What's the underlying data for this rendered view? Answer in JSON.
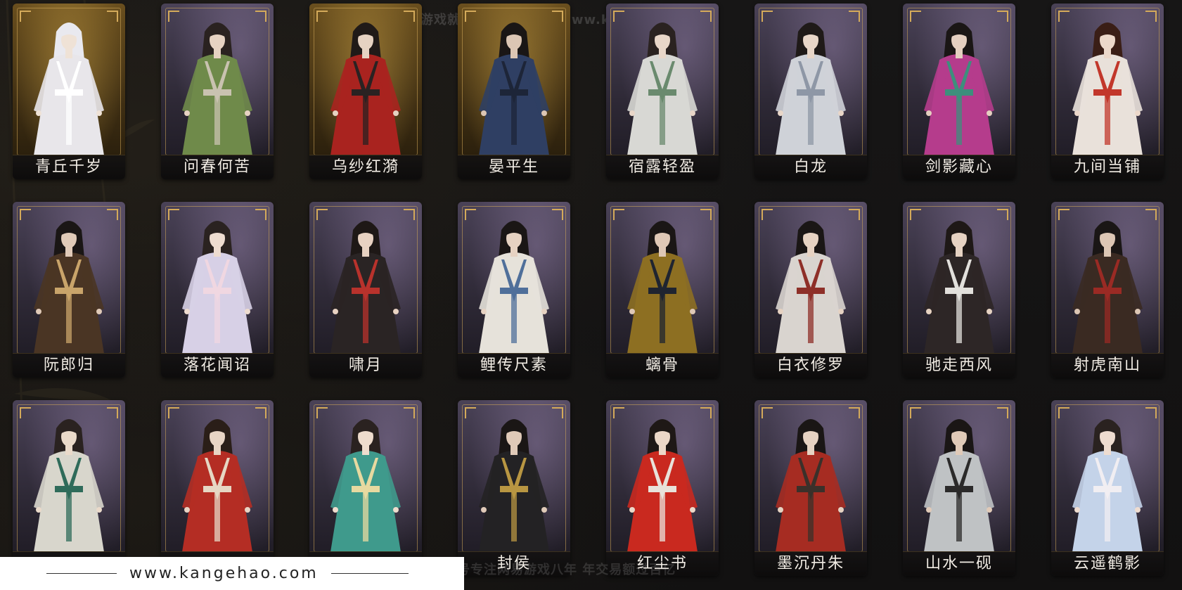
{
  "watermarks": {
    "top": "网易游戏就选看个号   网址：www.kangehao.com",
    "bottom": "看个号专注网易游戏八年   年交易额过百亿"
  },
  "footer": {
    "url": "www.kangehao.com"
  },
  "cards": [
    {
      "name": "青丘千岁",
      "frame": "gold",
      "outfit": "#e8e6ea",
      "trim": "#ffffff",
      "skin": "#efe2d6",
      "hair": "#e9e9ef"
    },
    {
      "name": "问春何苦",
      "frame": "purple",
      "outfit": "#6f8a4a",
      "trim": "#c9c2b0",
      "skin": "#e6d2c2",
      "hair": "#2a2220"
    },
    {
      "name": "乌纱红漪",
      "frame": "gold",
      "outfit": "#a9231f",
      "trim": "#2a2222",
      "skin": "#e6d2c2",
      "hair": "#201a18"
    },
    {
      "name": "晏平生",
      "frame": "gold",
      "outfit": "#2f3f63",
      "trim": "#1d2538",
      "skin": "#dcc6b4",
      "hair": "#1a1615"
    },
    {
      "name": "宿露轻盈",
      "frame": "purple",
      "outfit": "#d8d8d4",
      "trim": "#6a8a6e",
      "skin": "#e8d6c8",
      "hair": "#2a2220"
    },
    {
      "name": "白龙",
      "frame": "purple",
      "outfit": "#cfd2d8",
      "trim": "#8e97a6",
      "skin": "#e8d6c8",
      "hair": "#1f1a18"
    },
    {
      "name": "剑影藏心",
      "frame": "purple",
      "outfit": "#b53c8c",
      "trim": "#3d8f7c",
      "skin": "#e4cfc0",
      "hair": "#1a1615"
    },
    {
      "name": "九间当铺",
      "frame": "purple",
      "outfit": "#e9e1da",
      "trim": "#c2372b",
      "skin": "#ecd8ca",
      "hair": "#3a1e16"
    },
    {
      "name": "阮郎归",
      "frame": "purple",
      "outfit": "#4a3524",
      "trim": "#c9a46a",
      "skin": "#e0cab8",
      "hair": "#1a1615"
    },
    {
      "name": "落花闻诏",
      "frame": "purple",
      "outfit": "#d7d0e6",
      "trim": "#f0d7e1",
      "skin": "#eedcd0",
      "hair": "#2a2220"
    },
    {
      "name": "啸月",
      "frame": "purple",
      "outfit": "#2a2424",
      "trim": "#b8322c",
      "skin": "#e8d2c2",
      "hair": "#1e1816"
    },
    {
      "name": "鲤传尺素",
      "frame": "purple",
      "outfit": "#e6e2da",
      "trim": "#4f6f9a",
      "skin": "#e6d2c2",
      "hair": "#1a1615"
    },
    {
      "name": "螭骨",
      "frame": "purple",
      "outfit": "#8d6f22",
      "trim": "#1f2430",
      "skin": "#dfc8b6",
      "hair": "#1a1615"
    },
    {
      "name": "白衣修罗",
      "frame": "purple",
      "outfit": "#d9d4cf",
      "trim": "#8e2f28",
      "skin": "#e6d2c2",
      "hair": "#1a1615"
    },
    {
      "name": "驰走西风",
      "frame": "purple",
      "outfit": "#2d2626",
      "trim": "#e2e0dc",
      "skin": "#e6d2c2",
      "hair": "#1e1816"
    },
    {
      "name": "射虎南山",
      "frame": "purple",
      "outfit": "#3a2a22",
      "trim": "#9a2a24",
      "skin": "#dcc6b4",
      "hair": "#1a1615"
    },
    {
      "name": "",
      "frame": "purple",
      "outfit": "#d8d6cc",
      "trim": "#2f6b5a",
      "skin": "#eadaca",
      "hair": "#2a2220"
    },
    {
      "name": "",
      "frame": "purple",
      "outfit": "#b42d24",
      "trim": "#e6d7c4",
      "skin": "#e8d4c4",
      "hair": "#2a1e18"
    },
    {
      "name": "",
      "frame": "purple",
      "outfit": "#3f9a8c",
      "trim": "#e7d9a0",
      "skin": "#eedccd",
      "hair": "#2a2220"
    },
    {
      "name": "封侯",
      "frame": "purple",
      "outfit": "#232224",
      "trim": "#b89642",
      "skin": "#e0cab8",
      "hair": "#1a1615"
    },
    {
      "name": "红尘书",
      "frame": "purple",
      "outfit": "#c9291f",
      "trim": "#e8e2da",
      "skin": "#ecd8c8",
      "hair": "#1e1816"
    },
    {
      "name": "墨沉丹朱",
      "frame": "purple",
      "outfit": "#a62c22",
      "trim": "#3a302a",
      "skin": "#e6d2c2",
      "hair": "#1a1615"
    },
    {
      "name": "山水一砚",
      "frame": "purple",
      "outfit": "#bfc2c4",
      "trim": "#2b2a2a",
      "skin": "#e0cab8",
      "hair": "#1a1615"
    },
    {
      "name": "云遥鹤影",
      "frame": "purple",
      "outfit": "#c4d3e9",
      "trim": "#f1eef2",
      "skin": "#eedcd0",
      "hair": "#2a2220"
    }
  ]
}
